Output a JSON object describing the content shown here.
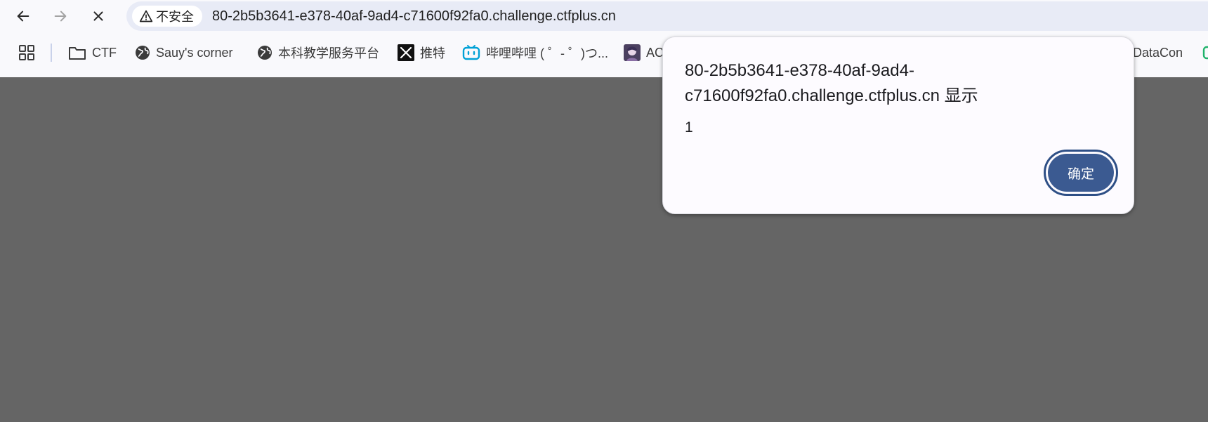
{
  "toolbar": {
    "security_label": "不安全",
    "url": "80-2b5b3641-e378-40af-9ad4-c71600f92fa0.challenge.ctfplus.cn",
    "icons": {
      "back": "back-arrow-icon",
      "forward": "forward-arrow-icon",
      "stop": "close-icon",
      "security": "warning-triangle-icon"
    }
  },
  "bookmarks": {
    "items": [
      {
        "label": "CTF",
        "icon": "folder-icon"
      },
      {
        "label": "Sauy's corner",
        "icon": "globe-icon"
      },
      {
        "label": "本科教学服务平台",
        "icon": "globe-icon"
      },
      {
        "label": "推特",
        "icon": "x-logo-icon"
      },
      {
        "label": "哔哩哔哩 ( ゜- ゜)つ...",
        "icon": "bilibili-icon"
      },
      {
        "label": "AC",
        "icon": "avatar-icon"
      },
      {
        "label": "DataCon",
        "icon": ""
      }
    ]
  },
  "dialog": {
    "title": "80-2b5b3641-e378-40af-9ad4-c71600f92fa0.challenge.ctfplus.cn 显示",
    "message": "1",
    "ok_label": "确定"
  },
  "colors": {
    "page_background": "#656565",
    "omnibox": "#e8ebf6",
    "button_primary": "#3b5a91"
  }
}
